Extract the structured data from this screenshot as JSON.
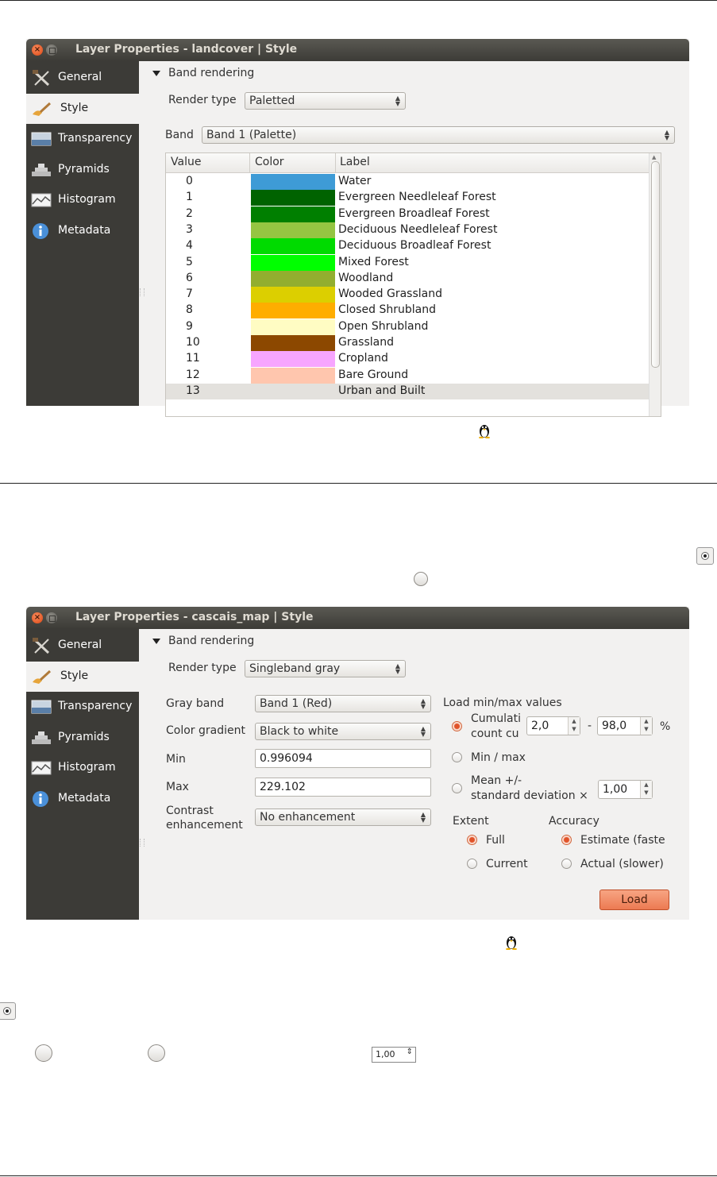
{
  "window1": {
    "title": "Layer Properties - landcover | Style",
    "sidebar": [
      {
        "label": "General",
        "icon": "tools-icon"
      },
      {
        "label": "Style",
        "icon": "paintbrush-icon"
      },
      {
        "label": "Transparency",
        "icon": "transparency-icon"
      },
      {
        "label": "Pyramids",
        "icon": "pyramids-icon"
      },
      {
        "label": "Histogram",
        "icon": "histogram-icon"
      },
      {
        "label": "Metadata",
        "icon": "info-icon"
      }
    ],
    "section_title": "Band rendering",
    "render_type_label": "Render type",
    "render_type_value": "Paletted",
    "band_label": "Band",
    "band_value": "Band 1 (Palette)",
    "table": {
      "headers": [
        "Value",
        "Color",
        "Label"
      ],
      "rows": [
        {
          "value": "0",
          "color": "#3e9bd6",
          "label": "Water"
        },
        {
          "value": "1",
          "color": "#006300",
          "label": "Evergreen Needleleaf Forest"
        },
        {
          "value": "2",
          "color": "#007f00",
          "label": "Evergreen Broadleaf Forest"
        },
        {
          "value": "3",
          "color": "#95c542",
          "label": "Deciduous Needleleaf Forest"
        },
        {
          "value": "4",
          "color": "#00db00",
          "label": "Deciduous Broadleaf Forest"
        },
        {
          "value": "5",
          "color": "#00ff00",
          "label": "Mixed Forest"
        },
        {
          "value": "6",
          "color": "#92ae2f",
          "label": "Woodland"
        },
        {
          "value": "7",
          "color": "#dccf00",
          "label": "Wooded Grassland"
        },
        {
          "value": "8",
          "color": "#ffad00",
          "label": "Closed Shrubland"
        },
        {
          "value": "9",
          "color": "#fffcc3",
          "label": "Open Shrubland"
        },
        {
          "value": "10",
          "color": "#8c4800",
          "label": "Grassland"
        },
        {
          "value": "11",
          "color": "#f7a5ff",
          "label": "Cropland"
        },
        {
          "value": "12",
          "color": "#ffc6ae",
          "label": "Bare Ground"
        },
        {
          "value": "13",
          "color": "#e3e1dd",
          "label": "Urban and Built"
        }
      ]
    }
  },
  "window2": {
    "title": "Layer Properties - cascais_map | Style",
    "sidebar": [
      {
        "label": "General",
        "icon": "tools-icon"
      },
      {
        "label": "Style",
        "icon": "paintbrush-icon"
      },
      {
        "label": "Transparency",
        "icon": "transparency-icon"
      },
      {
        "label": "Pyramids",
        "icon": "pyramids-icon"
      },
      {
        "label": "Histogram",
        "icon": "histogram-icon"
      },
      {
        "label": "Metadata",
        "icon": "info-icon"
      }
    ],
    "section_title": "Band rendering",
    "render_type_label": "Render type",
    "render_type_value": "Singleband gray",
    "gray_band_label": "Gray band",
    "gray_band_value": "Band 1 (Red)",
    "color_gradient_label": "Color gradient",
    "color_gradient_value": "Black to white",
    "min_label": "Min",
    "min_value": "0.996094",
    "max_label": "Max",
    "max_value": "229.102",
    "contrast_label_1": "Contrast",
    "contrast_label_2": "enhancement",
    "contrast_value": "No enhancement",
    "load_minmax_label": "Load min/max values",
    "cumulative_label_1": "Cumulati",
    "cumulative_label_2": "count cu",
    "cumulative_low": "2,0",
    "dash": "-",
    "cumulative_high": "98,0",
    "percent": "%",
    "minmax_label": "Min / max",
    "meanstd_label_1": "Mean +/-",
    "meanstd_label_2": "standard deviation ×",
    "meanstd_value": "1,00",
    "extent_label": "Extent",
    "extent_full": "Full",
    "extent_current": "Current",
    "accuracy_label": "Accuracy",
    "accuracy_estimate": "Estimate (faste",
    "accuracy_actual": "Actual (slower)",
    "load_button": "Load"
  },
  "doc": {
    "spin_value": "1,00"
  },
  "colors": {
    "sidebar_bg": "#3c3b37",
    "dialog_bg": "#f2f1f0",
    "accent": "#e0532a"
  }
}
